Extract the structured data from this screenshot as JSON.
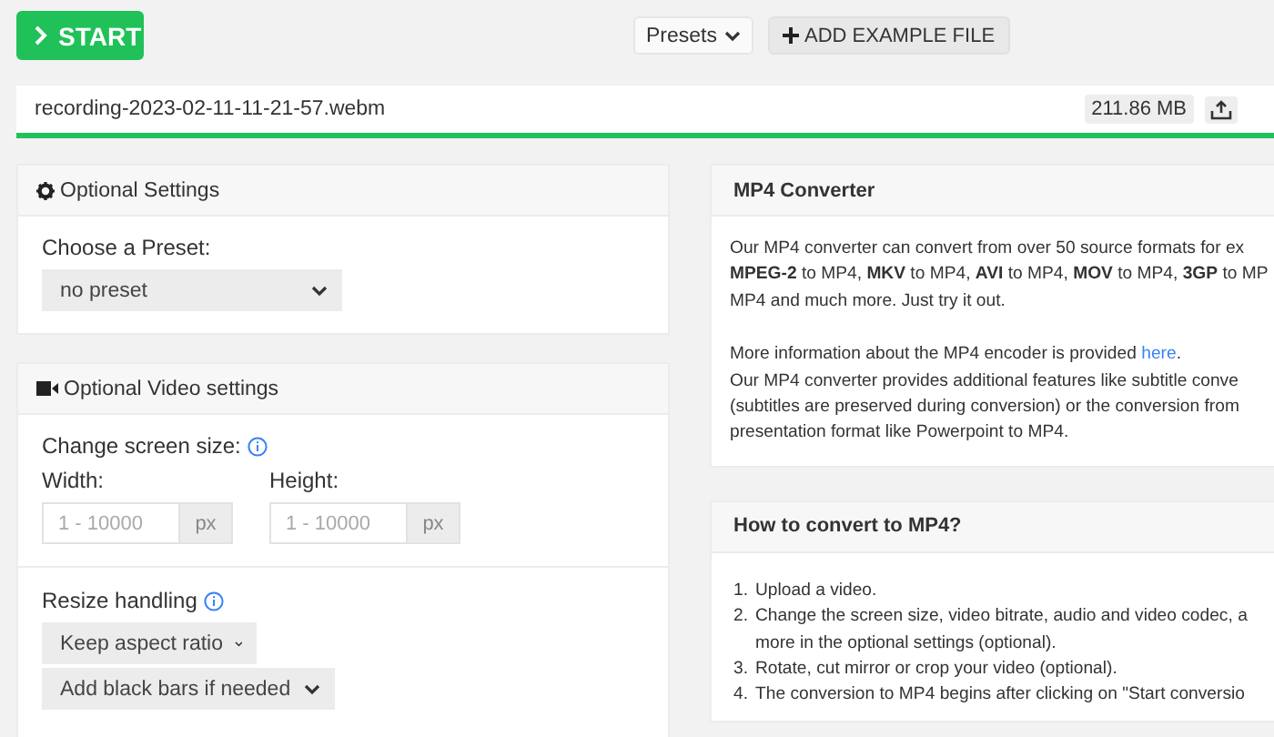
{
  "start_button": {
    "label": "START"
  },
  "presets_button": {
    "label": "Presets"
  },
  "add_example_button": {
    "label": "ADD EXAMPLE FILE"
  },
  "file": {
    "name": "recording-2023-02-11-11-21-57.webm",
    "size": "211.86 MB"
  },
  "optional_settings": {
    "title": "Optional Settings",
    "preset_label": "Choose a Preset:",
    "preset_select": "no preset"
  },
  "video_settings": {
    "title": "Optional Video settings",
    "screen_size_label": "Change screen size:",
    "width": {
      "label": "Width:",
      "placeholder": "1 - 10000",
      "unit": "px"
    },
    "height": {
      "label": "Height:",
      "placeholder": "1 - 10000",
      "unit": "px"
    },
    "resize_label": "Resize handling",
    "resize_selects": [
      "Keep aspect ratio",
      "Add black bars if needed"
    ]
  },
  "converter": {
    "title": "MP4 Converter",
    "intro_lines": [
      "Our MP4 converter can convert from over 50 source formats for ex",
      "**MPEG-2** to MP4, **MKV** to MP4, **AVI** to MP4, **MOV** to MP4, **3GP** to MP",
      "MP4 and much more. Just try it out."
    ],
    "info_before": "More information about the MP4 encoder is provided ",
    "info_link": "here",
    "info_after": ".",
    "feature_lines": [
      "Our MP4 converter provides additional features like subtitle conve",
      "(subtitles are preserved during conversion) or the conversion from",
      "presentation format like Powerpoint to MP4."
    ]
  },
  "how_to": {
    "title": "How to convert to MP4?",
    "steps": [
      {
        "number": "1.",
        "lines": [
          "Upload a video."
        ]
      },
      {
        "number": "2.",
        "lines": [
          "Change the screen size, video bitrate, audio and video codec, a",
          "more in the optional settings (optional)."
        ]
      },
      {
        "number": "3.",
        "lines": [
          "Rotate, cut mirror or crop your video (optional)."
        ]
      },
      {
        "number": "4.",
        "lines": [
          "The conversion to MP4 begins after clicking on \"Start conversio"
        ]
      }
    ]
  }
}
